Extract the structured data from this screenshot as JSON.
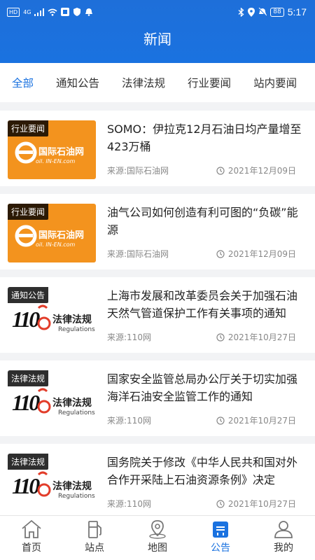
{
  "status": {
    "time": "5:17",
    "battery": "88",
    "left_chip": "HD",
    "network": "4G"
  },
  "header": {
    "title": "新闻"
  },
  "tabs": [
    {
      "label": "全部"
    },
    {
      "label": "通知公告"
    },
    {
      "label": "法律法规"
    },
    {
      "label": "行业要闻"
    },
    {
      "label": "站内要闻"
    }
  ],
  "articles": [
    {
      "category": "行业要闻",
      "title": "SOMO：伊拉克12月石油日均产量增至423万桶",
      "source": "来源:国际石油网",
      "date": "2021年12月09日",
      "logo_text": "国际石油网",
      "logo_sub": "oil. IN-EN.com"
    },
    {
      "category": "行业要闻",
      "title": "油气公司如何创造有利可图的“负碳”能源",
      "source": "来源:国际石油网",
      "date": "2021年12月09日",
      "logo_text": "国际石油网",
      "logo_sub": "oil. IN-EN.com"
    },
    {
      "category": "通知公告",
      "title": "上海市发展和改革委员会关于加强石油天然气管道保护工作有关事项的通知",
      "source": "来源:110网",
      "date": "2021年10月27日",
      "logo_text": "法律法规",
      "logo_sub": "Regulations",
      "logo_num": "110"
    },
    {
      "category": "法律法规",
      "title": "国家安全监管总局办公厅关于切实加强海洋石油安全监管工作的通知",
      "source": "来源:110网",
      "date": "2021年10月27日",
      "logo_text": "法律法规",
      "logo_sub": "Regulations",
      "logo_num": "110"
    },
    {
      "category": "法律法规",
      "title": "国务院关于修改《中华人民共和国对外合作开采陆上石油资源条例》决定",
      "source": "来源:110网",
      "date": "2021年10月27日",
      "logo_text": "法律法规",
      "logo_sub": "Regulations",
      "logo_num": "110"
    }
  ],
  "bottom_nav": [
    {
      "label": "首页",
      "icon": "home-icon"
    },
    {
      "label": "站点",
      "icon": "gas-station-icon"
    },
    {
      "label": "地图",
      "icon": "map-pin-icon"
    },
    {
      "label": "公告",
      "icon": "notice-icon",
      "active": true
    },
    {
      "label": "我的",
      "icon": "user-icon"
    }
  ],
  "colors": {
    "primary": "#1a72e0",
    "orange_logo": "#f3931e",
    "red_logo": "#e23d2a"
  }
}
